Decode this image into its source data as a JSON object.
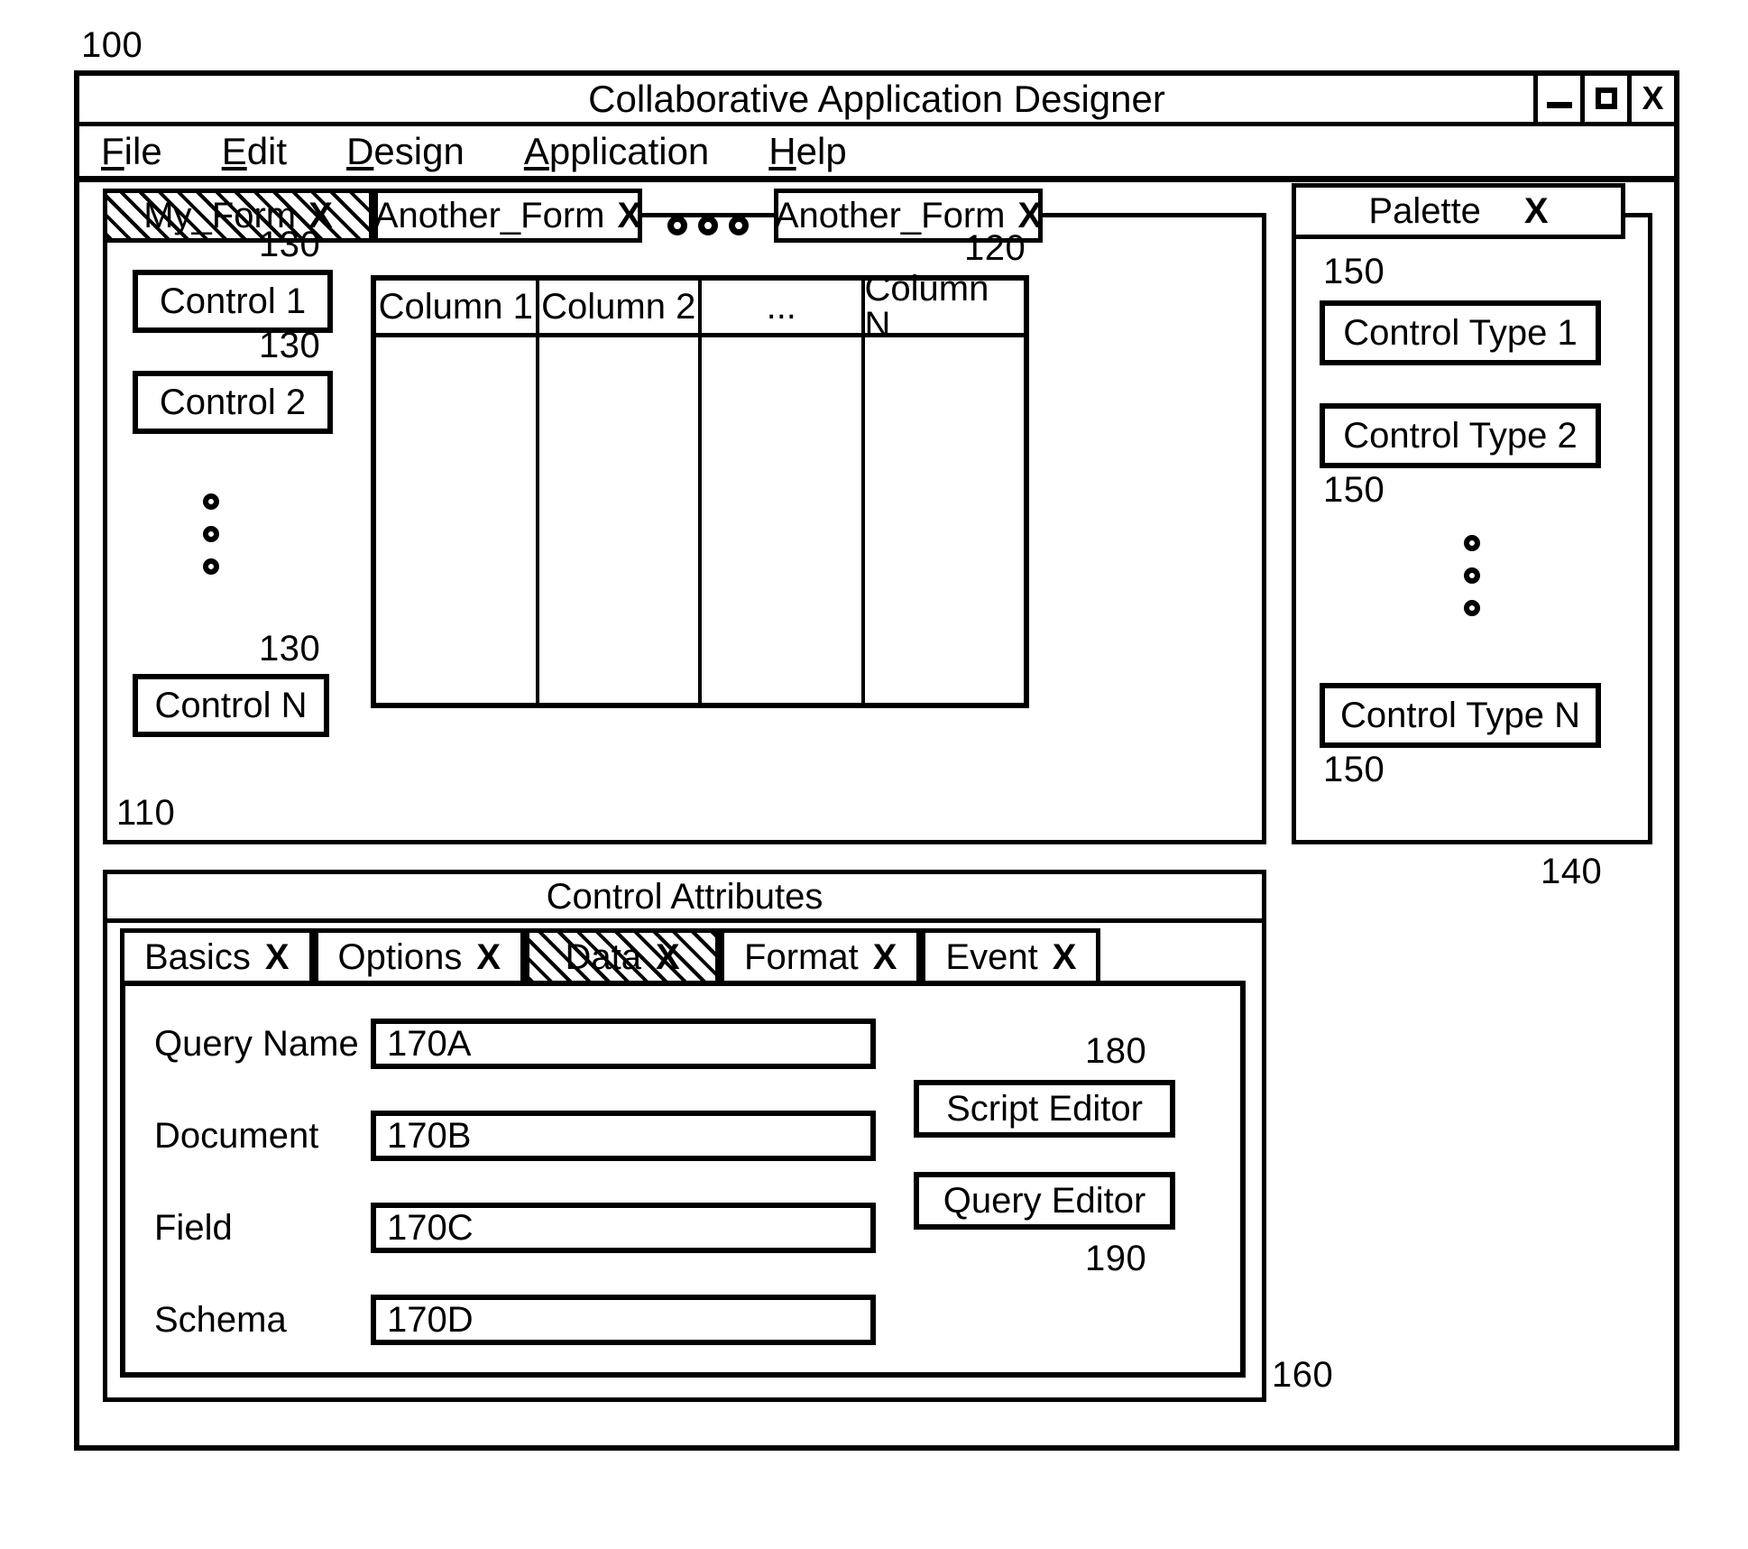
{
  "figure": {
    "root_ref": "100",
    "form_panel_ref": "110",
    "table_ref": "120",
    "control_ref": "130",
    "palette_panel_ref": "140",
    "palette_item_ref": "150",
    "attributes_panel_ref": "160",
    "script_editor_ref": "180",
    "query_editor_ref": "190"
  },
  "window": {
    "title": "Collaborative Application Designer",
    "controls": {
      "minimize": "—",
      "maximize": "□",
      "close": "X"
    }
  },
  "menu": {
    "items": [
      {
        "accel": "F",
        "rest": "ile"
      },
      {
        "accel": "E",
        "rest": "dit"
      },
      {
        "accel": "D",
        "rest": "esign"
      },
      {
        "accel": "A",
        "rest": "pplication"
      },
      {
        "accel": "H",
        "rest": "elp"
      }
    ]
  },
  "form_tabs": {
    "tabs": [
      {
        "label": "My_Form",
        "close": "X",
        "selected": true
      },
      {
        "label": "Another_Form",
        "close": "X",
        "selected": false
      },
      {
        "label": "Another_Form",
        "close": "X",
        "selected": false
      }
    ],
    "ellipsis": "○○○"
  },
  "form_panel": {
    "controls": [
      {
        "label": "Control 1",
        "ref": "130"
      },
      {
        "label": "Control 2",
        "ref": "130"
      },
      {
        "label": "Control N",
        "ref": "130"
      }
    ]
  },
  "data_table": {
    "ref": "120",
    "columns": [
      "Column 1",
      "Column 2",
      "...",
      "Column N"
    ],
    "rows": []
  },
  "palette": {
    "title": "Palette",
    "close": "X",
    "panel_ref": "140",
    "items": [
      {
        "label": "Control Type 1",
        "ref": "150"
      },
      {
        "label": "Control Type 2",
        "ref": "150"
      },
      {
        "label": "Control Type N",
        "ref": "150"
      }
    ]
  },
  "attributes": {
    "title": "Control Attributes",
    "panel_ref": "160",
    "tabs": [
      {
        "label": "Basics",
        "close": "X",
        "selected": false
      },
      {
        "label": "Options",
        "close": "X",
        "selected": false
      },
      {
        "label": "Data",
        "close": "X",
        "selected": true
      },
      {
        "label": "Format",
        "close": "X",
        "selected": false
      },
      {
        "label": "Event",
        "close": "X",
        "selected": false
      }
    ],
    "fields": [
      {
        "label": "Query Name",
        "value": "170A"
      },
      {
        "label": "Document",
        "value": "170B"
      },
      {
        "label": "Field",
        "value": "170C"
      },
      {
        "label": "Schema",
        "value": "170D"
      }
    ],
    "buttons": [
      {
        "label": "Script Editor",
        "ref": "180"
      },
      {
        "label": "Query Editor",
        "ref": "190"
      }
    ]
  }
}
